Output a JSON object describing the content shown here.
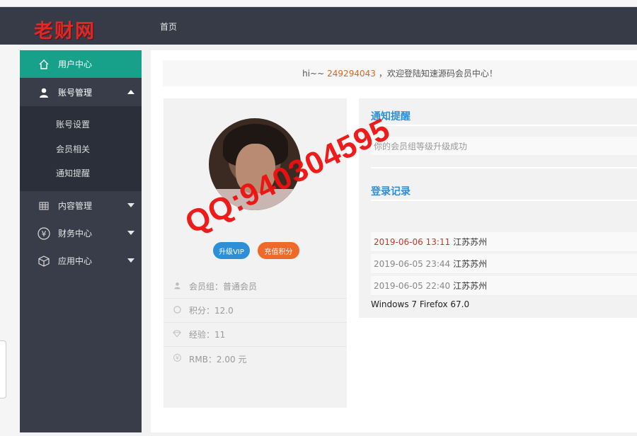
{
  "app": {
    "logo_text": "老财网",
    "nav_home": "首页"
  },
  "sidebar": {
    "items": [
      {
        "label": "用户中心",
        "icon": "home-icon",
        "active": true
      },
      {
        "label": "账号管理",
        "icon": "user-icon",
        "expanded": true
      },
      {
        "label": "内容管理",
        "icon": "grid-icon"
      },
      {
        "label": "财务中心",
        "icon": "yen-icon"
      },
      {
        "label": "应用中心",
        "icon": "cube-icon"
      }
    ],
    "sub_items": [
      "账号设置",
      "会员相关",
      "通知提醒"
    ]
  },
  "welcome": {
    "prefix": "hi~~",
    "user_id": "249294043",
    "suffix": "，欢迎登陆知速源码会员中心！"
  },
  "profile": {
    "vip_button": "升级VIP",
    "points_button": "充值积分",
    "rows": [
      {
        "label": "会员组：普通会员",
        "icon": "user-icon"
      },
      {
        "label": "积分：12.0",
        "icon": "circle-icon"
      },
      {
        "label": "经验：11",
        "icon": "diamond-icon"
      },
      {
        "label": "RMB：2.00 元",
        "icon": "yen-icon"
      }
    ]
  },
  "notice": {
    "title": "通知提醒",
    "message": "你的会员组等级升级成功"
  },
  "login_log": {
    "title": "登录记录",
    "rows": [
      {
        "time": "2019-06-06 13:11",
        "city": "江苏苏州"
      },
      {
        "time": "2019-06-05 23:44",
        "city": "江苏苏州"
      },
      {
        "time": "2019-06-05 22:40",
        "city": "江苏苏州"
      }
    ],
    "user_agent": "Windows 7 Firefox 67.0"
  },
  "watermark": "QQ:940304595",
  "colors": {
    "topbar": "#363b47",
    "sidebar": "#393d49",
    "active": "#17a08a",
    "accent_blue": "#2d8fd8",
    "accent_orange": "#ef6a2a",
    "watermark_red": "#ee1010"
  }
}
